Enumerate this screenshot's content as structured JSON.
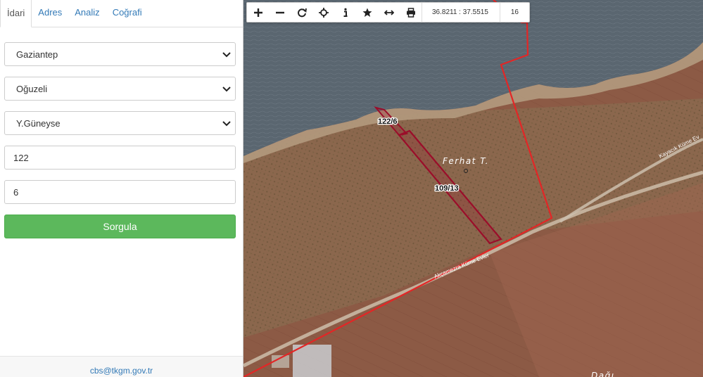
{
  "tabs": [
    {
      "label": "İdari",
      "active": true
    },
    {
      "label": "Adres"
    },
    {
      "label": "Analiz"
    },
    {
      "label": "Coğrafi"
    }
  ],
  "form": {
    "province": "Gaziantep",
    "district": "Oğuzeli",
    "neighborhood": "Y.Güneyse",
    "block": "122",
    "parcel": "6",
    "submit_label": "Sorgula"
  },
  "footer": {
    "email": "cbs@tkgm.gov.tr"
  },
  "toolbar": {
    "icons": [
      "zoom-in-icon",
      "zoom-out-icon",
      "refresh-icon",
      "locate-icon",
      "info-icon",
      "bookmark-star-icon",
      "measure-icon",
      "print-icon"
    ],
    "coordinates": "36.8211 : 37.5515",
    "zoom_level": "16"
  },
  "map": {
    "parcel_labels": [
      "122/6",
      "109/13"
    ],
    "place_labels": [
      "Ferhat T.",
      "Dağı"
    ],
    "road_labels": [
      "Akçamezra Küme Evler",
      "Kayacık Küme Ev"
    ],
    "colors": {
      "boundary": "#e32626",
      "parcel": "#9b0d2a",
      "primary": "#5cb85c",
      "link": "#337ab7"
    }
  }
}
